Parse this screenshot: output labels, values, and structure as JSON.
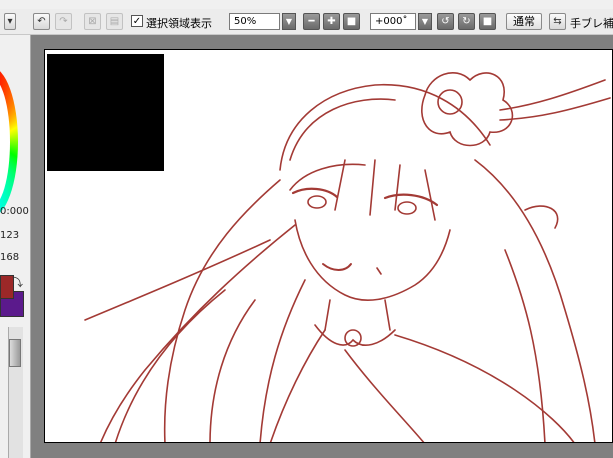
{
  "toolbar": {
    "show_selection_label": "選択領域表示",
    "show_selection_checked": "✓",
    "zoom_value": "50%",
    "rotation_value": "+000˚",
    "blend_mode_label": "通常",
    "hand_shake_label": "手ブレ補"
  },
  "left_panel": {
    "values": [
      "0:000",
      "123",
      "168"
    ],
    "colors": {
      "primary": "#9b2828",
      "secondary": "#5b1a8c"
    }
  },
  "canvas": {
    "line_color": "#a33a35"
  }
}
